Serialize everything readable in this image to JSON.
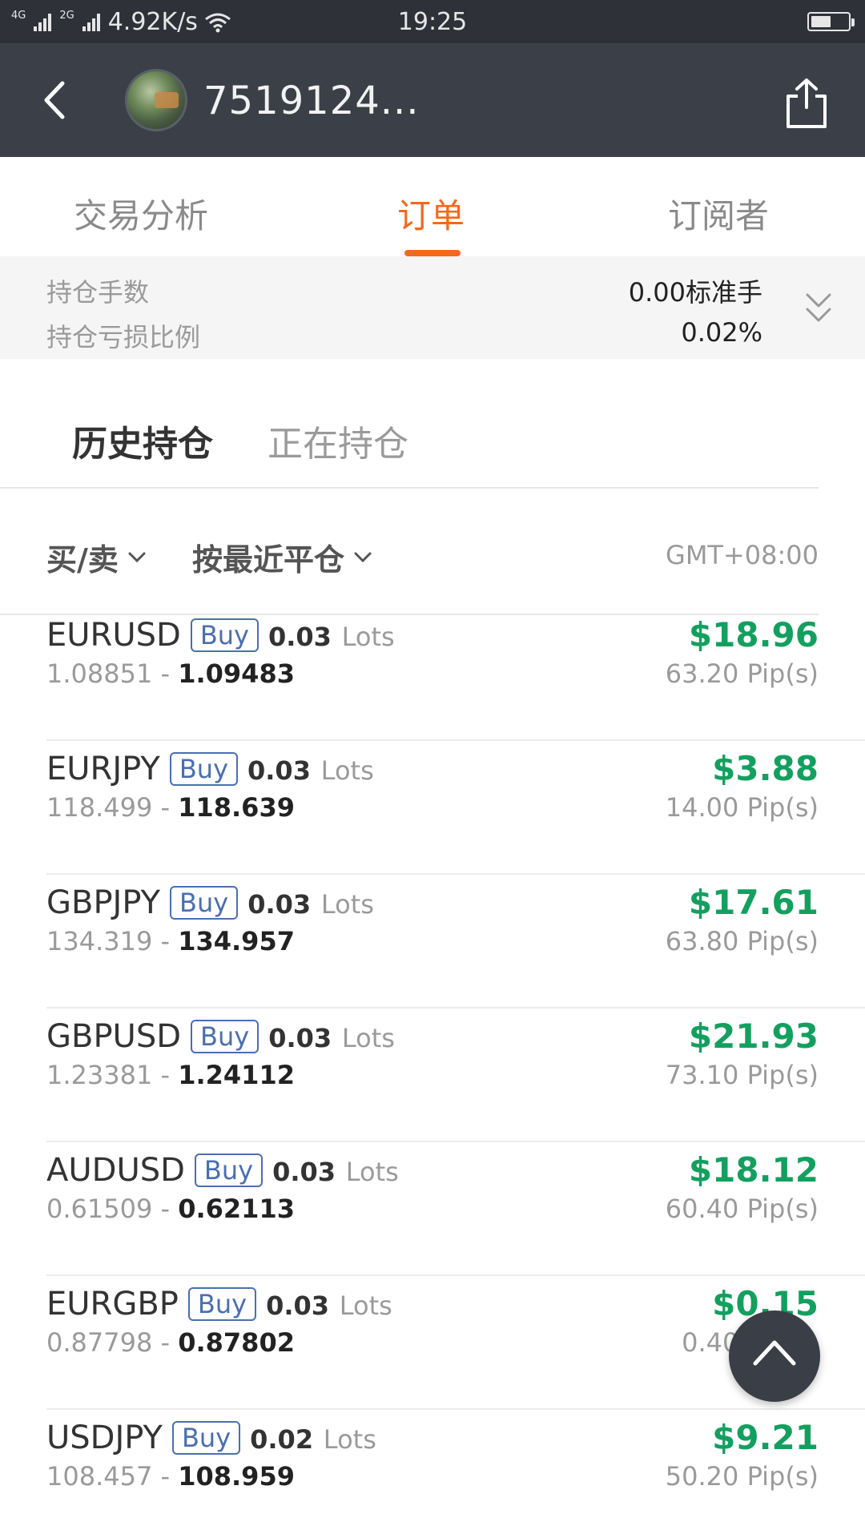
{
  "status_bar": {
    "net1": "4G",
    "net2": "2G",
    "speed": "4.92K/s",
    "time": "19:25",
    "battery_level_percent": 55
  },
  "header": {
    "username": "7519124...",
    "back_icon": "chevron-left-icon",
    "share_icon": "share-icon"
  },
  "tabs": [
    {
      "label": "交易分析"
    },
    {
      "label": "订单"
    },
    {
      "label": "订阅者"
    }
  ],
  "summary": {
    "lots_label": "持仓手数",
    "lots_value": "0.00标准手",
    "pl_ratio_label": "持仓亏损比例",
    "pl_ratio_value": "0.02%"
  },
  "subtabs": {
    "history": "历史持仓",
    "open": "正在持仓"
  },
  "filters": {
    "side": "买/卖",
    "sort": "按最近平仓",
    "timezone": "GMT+08:00"
  },
  "colors": {
    "accent": "#f5681a",
    "profit": "#13a05f",
    "buy_badge": "#4a6fb0",
    "header_bg": "#3b4048"
  },
  "orders": [
    {
      "symbol": "EURUSD",
      "side": "Buy",
      "lots": "0.03",
      "lots_unit": "Lots",
      "open": "1.08851",
      "sep": " - ",
      "close": "1.09483",
      "profit": "$18.96",
      "pips": "63.20 Pip(s)"
    },
    {
      "symbol": "EURJPY",
      "side": "Buy",
      "lots": "0.03",
      "lots_unit": "Lots",
      "open": "118.499",
      "sep": " - ",
      "close": "118.639",
      "profit": "$3.88",
      "pips": "14.00 Pip(s)"
    },
    {
      "symbol": "GBPJPY",
      "side": "Buy",
      "lots": "0.03",
      "lots_unit": "Lots",
      "open": "134.319",
      "sep": " - ",
      "close": "134.957",
      "profit": "$17.61",
      "pips": "63.80 Pip(s)"
    },
    {
      "symbol": "GBPUSD",
      "side": "Buy",
      "lots": "0.03",
      "lots_unit": "Lots",
      "open": "1.23381",
      "sep": " - ",
      "close": "1.24112",
      "profit": "$21.93",
      "pips": "73.10 Pip(s)"
    },
    {
      "symbol": "AUDUSD",
      "side": "Buy",
      "lots": "0.03",
      "lots_unit": "Lots",
      "open": "0.61509",
      "sep": " - ",
      "close": "0.62113",
      "profit": "$18.12",
      "pips": "60.40 Pip(s)"
    },
    {
      "symbol": "EURGBP",
      "side": "Buy",
      "lots": "0.03",
      "lots_unit": "Lots",
      "open": "0.87798",
      "sep": " - ",
      "close": "0.87802",
      "profit": "$0.15",
      "pips": "0.40 Pip(s)"
    },
    {
      "symbol": "USDJPY",
      "side": "Buy",
      "lots": "0.02",
      "lots_unit": "Lots",
      "open": "108.457",
      "sep": " - ",
      "close": "108.959",
      "profit": "$9.21",
      "pips": "50.20 Pip(s)"
    }
  ]
}
